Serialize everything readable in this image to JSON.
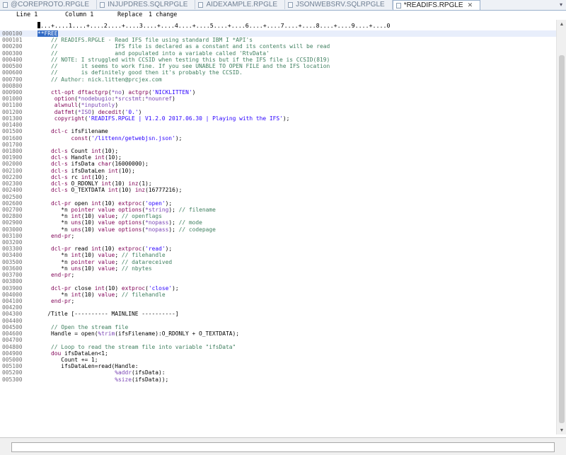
{
  "tabs": [
    {
      "label": "@COREPROTO.RPGLE",
      "active": false
    },
    {
      "label": "INJUPDRES.SQLRPGLE",
      "active": false
    },
    {
      "label": "AIDEXAMPLE.RPGLE",
      "active": false
    },
    {
      "label": "JSONWEBSRV.SQLRPGLE",
      "active": false
    },
    {
      "label": "*READIFS.RPGLE",
      "active": true
    }
  ],
  "status": {
    "line_label": "Line 1",
    "column_label": "Column 1",
    "mode_label": "Replace",
    "changes_label": "1 change"
  },
  "ruler": "...+....1....+....2....+....3....+....4....+....5....+....6....+....7....+....8....+....9....+....0",
  "lines": [
    {
      "seq": "000100",
      "code": "**FREE"
    },
    {
      "seq": "000101",
      "code": "    // READIFS.RPGLE - Read IFS file using standard IBM I *API's"
    },
    {
      "seq": "000200",
      "code": "    //                 IFS file is declared as a constant and its contents will be read"
    },
    {
      "seq": "000300",
      "code": "    //                 and populated into a variable called 'RtvData'"
    },
    {
      "seq": "000400",
      "code": "    // NOTE: I struggled with CCSID when testing this but if the IFS file is CCSID(819)"
    },
    {
      "seq": "000500",
      "code": "    //       it seems to work fine. If you see UNABLE TO OPEN FILE and the IFS location"
    },
    {
      "seq": "000600",
      "code": "    //       is definitely good then it's probably the CCSID."
    },
    {
      "seq": "000700",
      "code": "    // Author: nick.litten@prcjex.com"
    },
    {
      "seq": "000800",
      "code": ""
    },
    {
      "seq": "000900",
      "code": "    ctl-opt dftactgrp(*no) actgrp('NICKLITTEN')"
    },
    {
      "seq": "001000",
      "code": "     option(*nodebugio:*srcstmt:*nounref)"
    },
    {
      "seq": "001100",
      "code": "     alwnull(*inputonly)"
    },
    {
      "seq": "001200",
      "code": "     datfmt(*ISO) decedit('0.')"
    },
    {
      "seq": "001300",
      "code": "     copyright('READIFS.RPGLE | V1.2.0 2017.06.30 | Playing with the IFS');"
    },
    {
      "seq": "001400",
      "code": ""
    },
    {
      "seq": "001500",
      "code": "    dcl-c ifsFilename"
    },
    {
      "seq": "001600",
      "code": "          const('/littenn/getwebjsn.json');"
    },
    {
      "seq": "001700",
      "code": ""
    },
    {
      "seq": "001800",
      "code": "    dcl-s Count int(10);"
    },
    {
      "seq": "001900",
      "code": "    dcl-s Handle int(10);"
    },
    {
      "seq": "002000",
      "code": "    dcl-s ifsData char(16000000);"
    },
    {
      "seq": "002100",
      "code": "    dcl-s ifsDataLen int(10);"
    },
    {
      "seq": "002200",
      "code": "    dcl-s rc int(10);"
    },
    {
      "seq": "002300",
      "code": "    dcl-s O_RDONLY int(10) inz(1);"
    },
    {
      "seq": "002400",
      "code": "    dcl-s O_TEXTDATA int(10) inz(16777216);"
    },
    {
      "seq": "002500",
      "code": ""
    },
    {
      "seq": "002600",
      "code": "    dcl-pr open int(10) extproc('open');"
    },
    {
      "seq": "002700",
      "code": "       *n pointer value options(*string); // filename"
    },
    {
      "seq": "002800",
      "code": "       *n int(10) value; // openflags"
    },
    {
      "seq": "002900",
      "code": "       *n uns(10) value options(*nopass); // mode"
    },
    {
      "seq": "003000",
      "code": "       *n uns(10) value options(*nopass); // codepage"
    },
    {
      "seq": "003100",
      "code": "    end-pr;"
    },
    {
      "seq": "003200",
      "code": ""
    },
    {
      "seq": "003300",
      "code": "    dcl-pr read int(10) extproc('read');"
    },
    {
      "seq": "003400",
      "code": "       *n int(10) value; // filehandle"
    },
    {
      "seq": "003500",
      "code": "       *n pointer value; // datareceived"
    },
    {
      "seq": "003600",
      "code": "       *n uns(10) value; // nbytes"
    },
    {
      "seq": "003700",
      "code": "    end-pr;"
    },
    {
      "seq": "003800",
      "code": ""
    },
    {
      "seq": "003900",
      "code": "    dcl-pr close int(10) extproc('close');"
    },
    {
      "seq": "004000",
      "code": "       *n int(10) value; // filehandle"
    },
    {
      "seq": "004100",
      "code": "    end-pr;"
    },
    {
      "seq": "004200",
      "code": ""
    },
    {
      "seq": "004300",
      "code": "   /Title [---------- MAINLINE ----------]"
    },
    {
      "seq": "004400",
      "code": ""
    },
    {
      "seq": "004500",
      "code": "    // Open the stream file"
    },
    {
      "seq": "004600",
      "code": "    Handle = open(%trim(ifsFilename):O_RDONLY + O_TEXTDATA);"
    },
    {
      "seq": "004700",
      "code": ""
    },
    {
      "seq": "004800",
      "code": "    // Loop to read the stream file into variable \"ifsData\""
    },
    {
      "seq": "004900",
      "code": "    dou ifsDataLen<1;"
    },
    {
      "seq": "005000",
      "code": "       Count += 1;"
    },
    {
      "seq": "005100",
      "code": "       ifsDataLen=read(Handle:"
    },
    {
      "seq": "005200",
      "code": "                       %addr(ifsData):"
    },
    {
      "seq": "005300",
      "code": "                       %size(ifsData));"
    }
  ],
  "icons": {
    "tab_file": "file-icon",
    "tab_close": "close-icon",
    "tab_menu": "chevron-down-icon",
    "scroll_up": "arrow-up-icon",
    "scroll_down": "arrow-down-icon"
  },
  "colors": {
    "comment": "#3f7f5f",
    "keyword": "#7f0055",
    "string": "#2a00ff",
    "builtin": "#7b46b5",
    "selection": "#316ac5",
    "current_line": "#e8eefb"
  }
}
